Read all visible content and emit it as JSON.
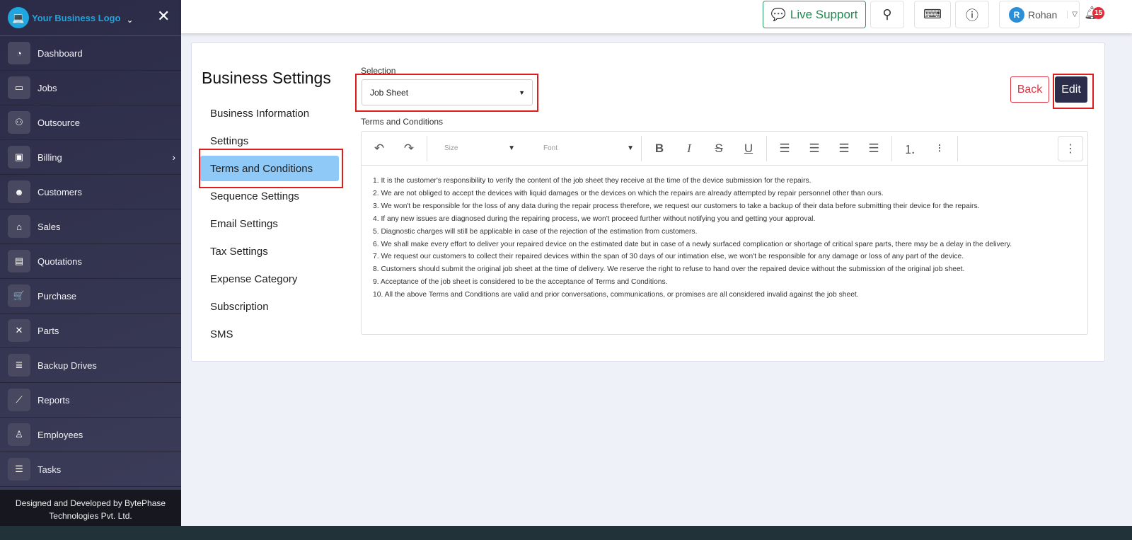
{
  "sidebar": {
    "brand": "Your Business Logo",
    "items": [
      {
        "label": "Dashboard",
        "icon": "gauge-icon",
        "g": "◔"
      },
      {
        "label": "Jobs",
        "icon": "ticket-icon",
        "g": "▭"
      },
      {
        "label": "Outsource",
        "icon": "people-icon",
        "g": "⚇"
      },
      {
        "label": "Billing",
        "icon": "wallet-icon",
        "g": "▣"
      },
      {
        "label": "Customers",
        "icon": "users-icon",
        "g": "☻"
      },
      {
        "label": "Sales",
        "icon": "store-icon",
        "g": "⌂"
      },
      {
        "label": "Quotations",
        "icon": "document-icon",
        "g": "▤"
      },
      {
        "label": "Purchase",
        "icon": "cart-icon",
        "g": "🛒"
      },
      {
        "label": "Parts",
        "icon": "tools-icon",
        "g": "✕"
      },
      {
        "label": "Backup Drives",
        "icon": "database-icon",
        "g": "≣"
      },
      {
        "label": "Reports",
        "icon": "chart-icon",
        "g": "⟋"
      },
      {
        "label": "Employees",
        "icon": "person-icon",
        "g": "♙"
      },
      {
        "label": "Tasks",
        "icon": "tasks-icon",
        "g": "☰"
      }
    ],
    "footer": "Designed and Developed by BytePhase Technologies Pvt. Ltd."
  },
  "topbar": {
    "live_support": "Live Support",
    "user": "Rohan",
    "user_initial": "R",
    "notifications": "15"
  },
  "main": {
    "title": "Business Settings",
    "menu": [
      "Business Information",
      "Settings",
      "Terms and Conditions",
      "Sequence Settings",
      "Email Settings",
      "Tax Settings",
      "Expense Category",
      "Subscription",
      "SMS"
    ],
    "active_menu": "Terms and Conditions",
    "selection_label": "Selection",
    "selection_value": "Job Sheet",
    "back": "Back",
    "edit": "Edit",
    "tc_label": "Terms and Conditions",
    "toolbar": {
      "size": "Size",
      "font": "Font"
    },
    "terms": [
      "1. It is the customer's responsibility to verify the content of the job sheet they receive at the time of the device submission for the repairs.",
      "2. We are not obliged to accept the devices with liquid damages or the devices on which the repairs are already attempted by repair personnel other than ours.",
      "3. We won't be responsible for the loss of any data during the repair process therefore, we request our customers to take a backup of their data before submitting their device for the repairs.",
      "4. If any new issues are diagnosed during the repairing process, we won't proceed further without notifying you and getting your approval.",
      "5. Diagnostic charges will still be applicable in case of the rejection of the estimation from customers.",
      "6. We shall make every effort to deliver your repaired device on the estimated date but in case of a newly surfaced complication or shortage of critical spare parts, there may be a delay in the delivery.",
      "7. We request our customers to collect their repaired devices within the span of 30 days of our intimation else, we won't be responsible for any damage or loss of any part of the device.",
      "8. Customers should submit the original job sheet at the time of delivery. We reserve the right to refuse to hand over the repaired device without the submission of the original job sheet.",
      "9. Acceptance of the job sheet is considered to be the acceptance of Terms and Conditions.",
      "10. All the above Terms and Conditions are valid and prior conversations, communications, or promises are all considered invalid against the job sheet."
    ]
  },
  "colors": {
    "sidebar": "#2f3049",
    "accent": "#8ec9f7",
    "live_support": "#1f8a52",
    "back": "#dc3545",
    "edit": "#2b2d4a",
    "highlight": "#e01d1d"
  }
}
